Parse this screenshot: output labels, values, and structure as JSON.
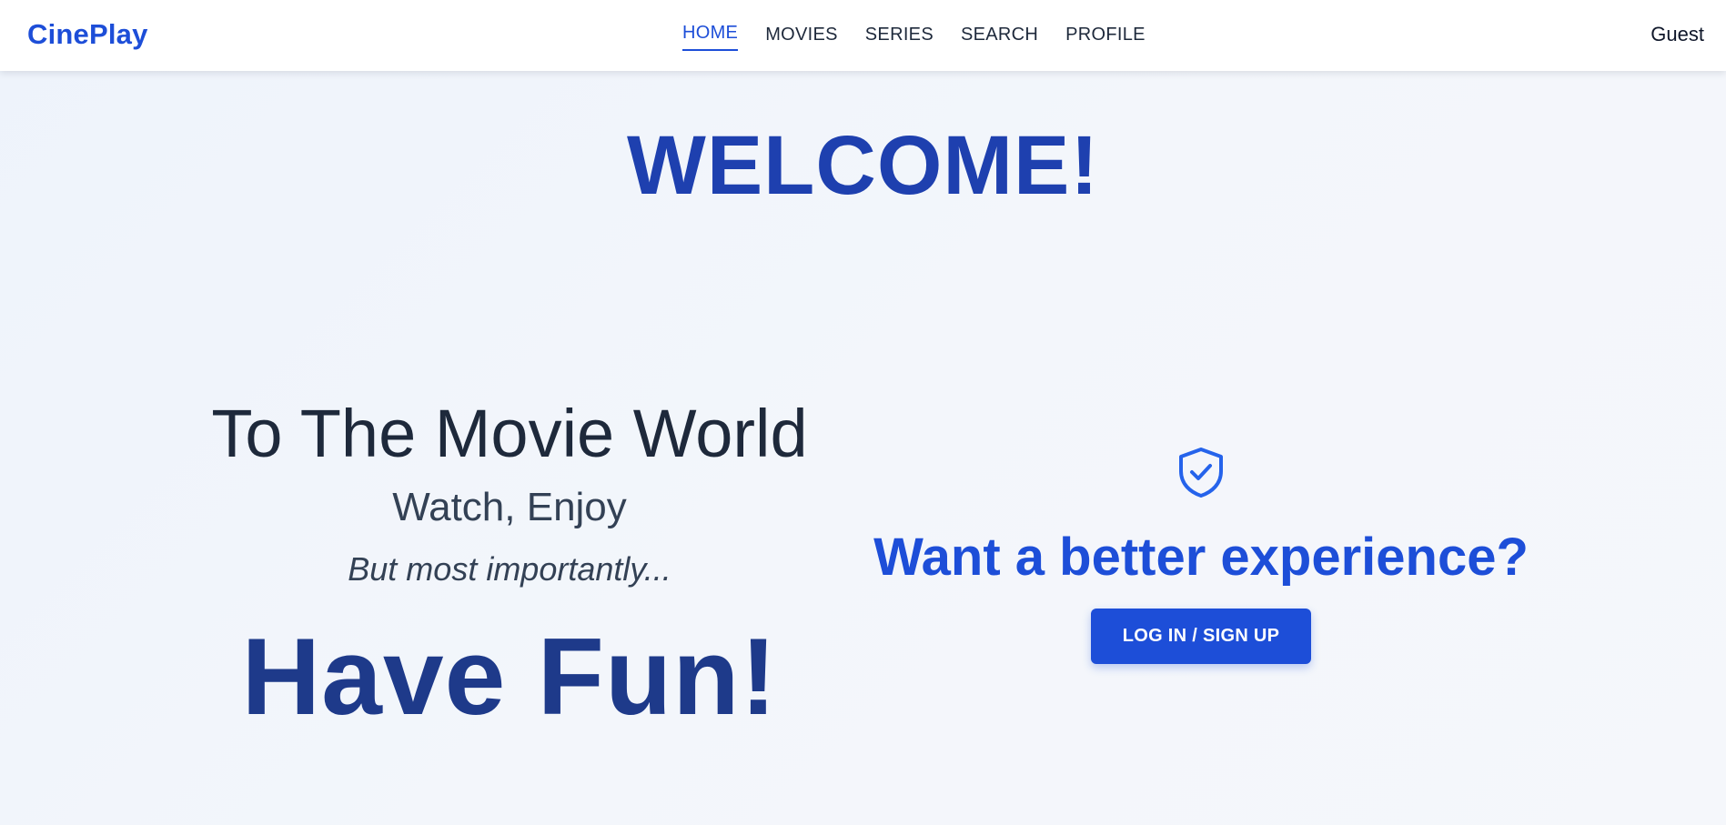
{
  "brand": "CinePlay",
  "nav": {
    "items": [
      {
        "label": "HOME",
        "active": true
      },
      {
        "label": "MOVIES",
        "active": false
      },
      {
        "label": "SERIES",
        "active": false
      },
      {
        "label": "SEARCH",
        "active": false
      },
      {
        "label": "PROFILE",
        "active": false
      }
    ],
    "user": "Guest"
  },
  "hero": {
    "welcome": "WELCOME!",
    "headline": "To The Movie World",
    "subtitle": "Watch, Enjoy",
    "tagline": "But most importantly...",
    "fun": "Have Fun!"
  },
  "cta": {
    "icon": "shield-check-icon",
    "heading": "Want a better experience?",
    "button_label": "LOG IN / SIGN UP"
  },
  "colors": {
    "accent": "#1d4ed8",
    "dark_accent": "#1e3a8a",
    "background": "#f1f5fb"
  }
}
